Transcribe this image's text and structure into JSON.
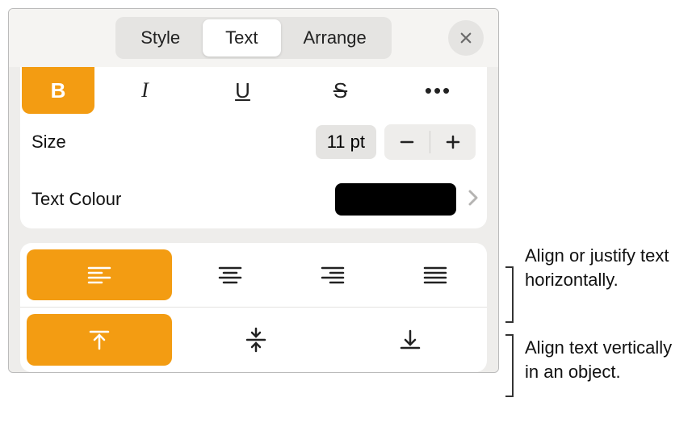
{
  "tabs": {
    "style": "Style",
    "text": "Text",
    "arrange": "Arrange",
    "active": "text"
  },
  "format": {
    "bold_glyph": "B",
    "italic_glyph": "I",
    "underline_glyph": "U",
    "strike_glyph": "S",
    "more_glyph": "•••",
    "active": "bold"
  },
  "size": {
    "label": "Size",
    "value": "11 pt"
  },
  "text_colour": {
    "label": "Text Colour",
    "value_hex": "#000000"
  },
  "h_align": {
    "active": "left"
  },
  "v_align": {
    "active": "top"
  },
  "callouts": {
    "horizontal": "Align or justify text horizontally.",
    "vertical": "Align text vertically in an object."
  }
}
